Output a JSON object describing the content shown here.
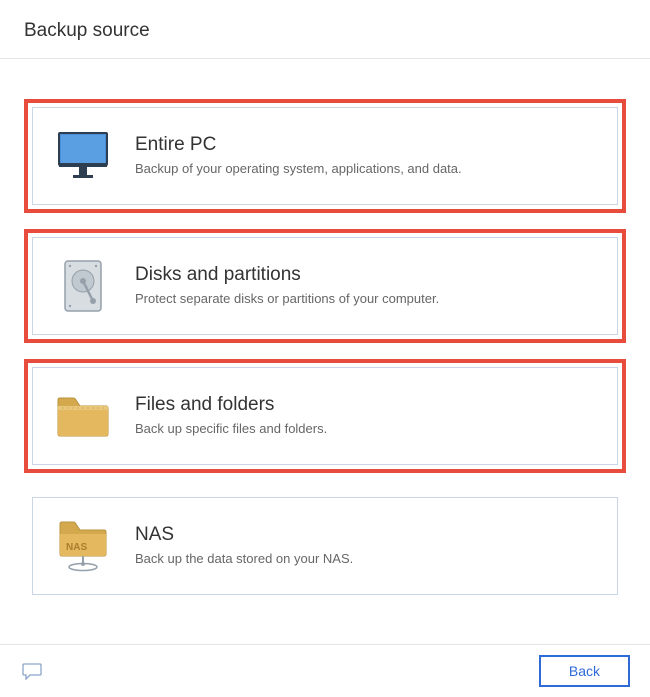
{
  "header": {
    "title": "Backup source"
  },
  "options": [
    {
      "title": "Entire PC",
      "desc": "Backup of your operating system, applications, and data."
    },
    {
      "title": "Disks and partitions",
      "desc": "Protect separate disks or partitions of your computer."
    },
    {
      "title": "Files and folders",
      "desc": "Back up specific files and folders."
    },
    {
      "title": "NAS",
      "desc": "Back up the data stored on your NAS."
    }
  ],
  "footer": {
    "back_label": "Back"
  }
}
